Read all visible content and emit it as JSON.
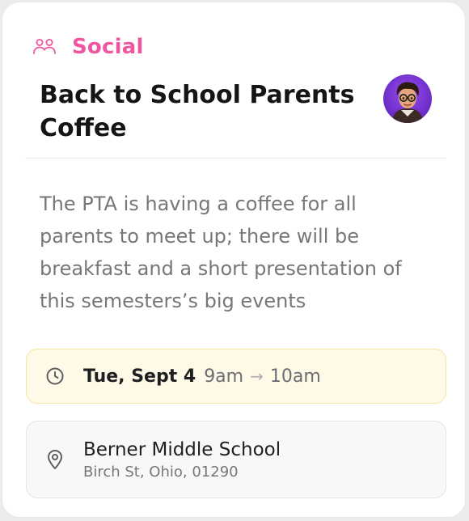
{
  "event": {
    "category": "Social",
    "category_icon": "people-group-icon",
    "accent_color": "#f0569f",
    "title": "Back to School Parents Coffee",
    "description": "The PTA is having a coffee for all parents to meet up; there will be breakfast and a short presentation of this semesters’s big events",
    "schedule": {
      "icon": "clock-icon",
      "date": "Tue, Sept 4",
      "start": "9am",
      "arrow": "→",
      "end": "10am"
    },
    "location": {
      "icon": "map-pin-icon",
      "name": "Berner Middle School",
      "address": "Birch St, Ohio, 01290"
    }
  }
}
